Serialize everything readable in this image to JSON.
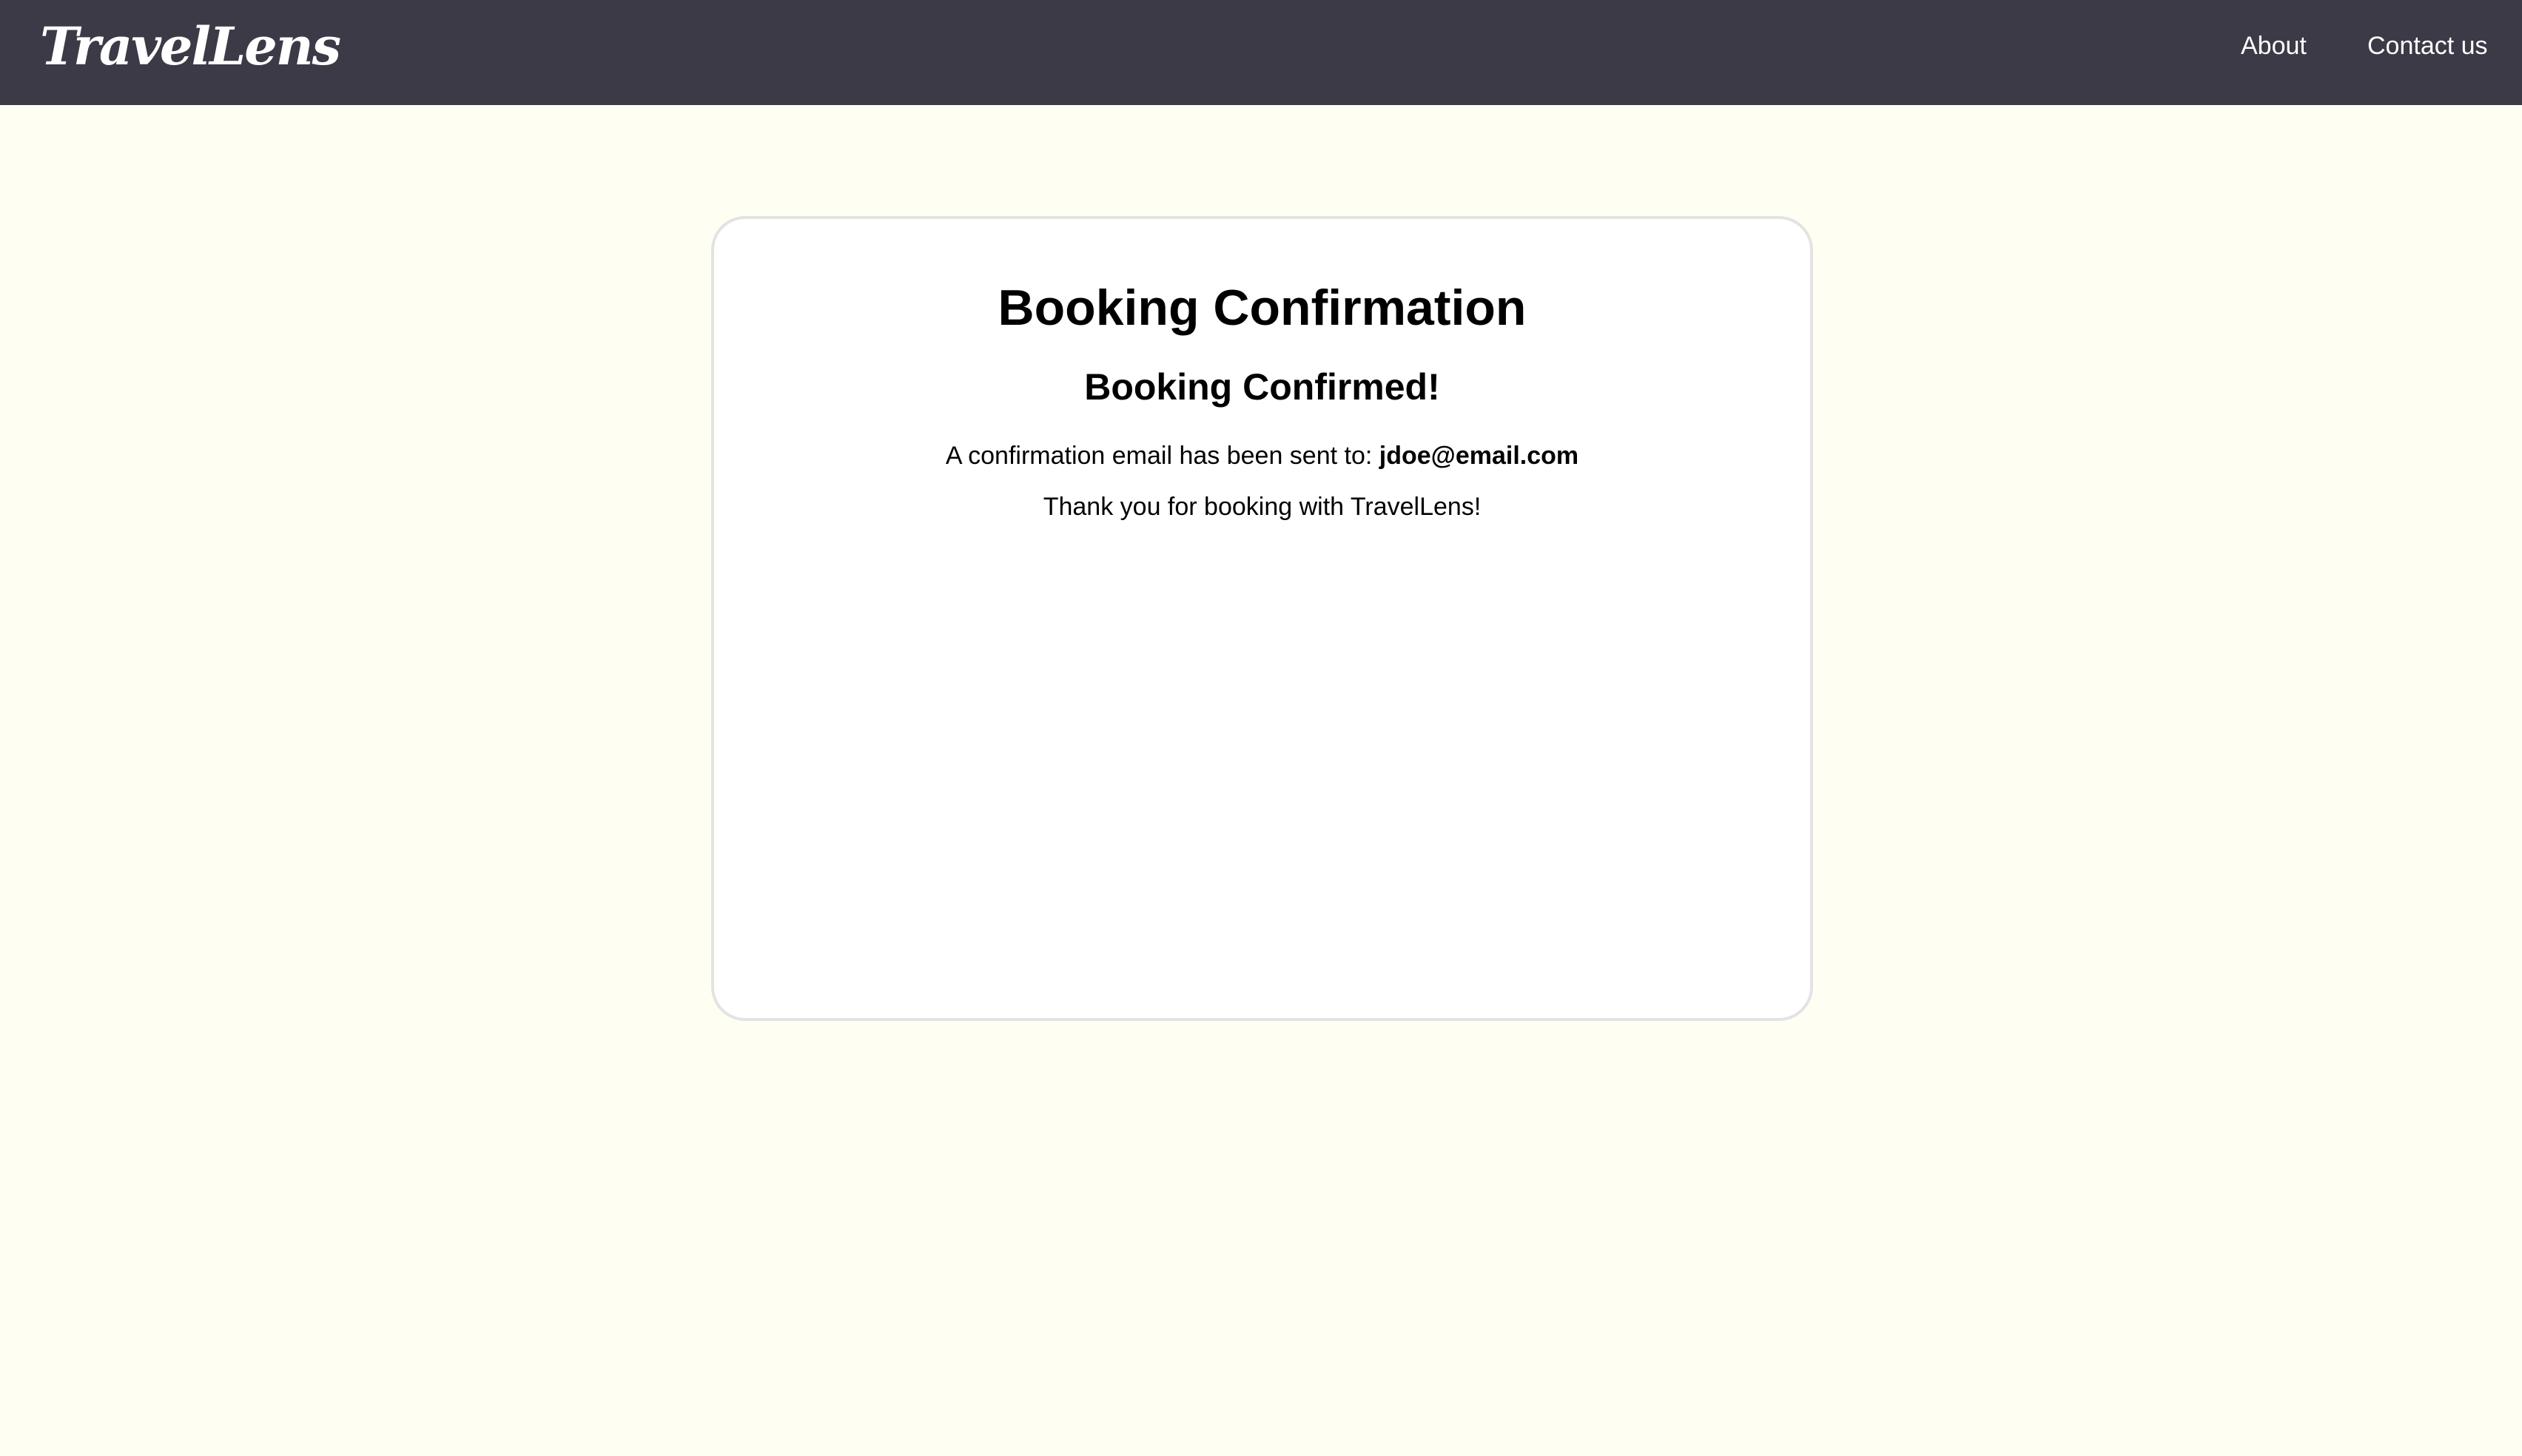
{
  "nav": {
    "logo": "TravelLens",
    "links": [
      "About",
      "Contact us"
    ]
  },
  "confirmation": {
    "title": "Booking Confirmation",
    "status": "Booking Confirmed!",
    "email_prefix": "A confirmation email has been sent to:",
    "email": "jdoe@email.com",
    "thanks": "Thank you for booking with TravelLens!"
  },
  "colors": {
    "navbar_bg": "#3C3A46",
    "page_bg": "#FEFFF2",
    "card_bg": "#FFFFFF",
    "card_border": "#E3E3E3"
  }
}
